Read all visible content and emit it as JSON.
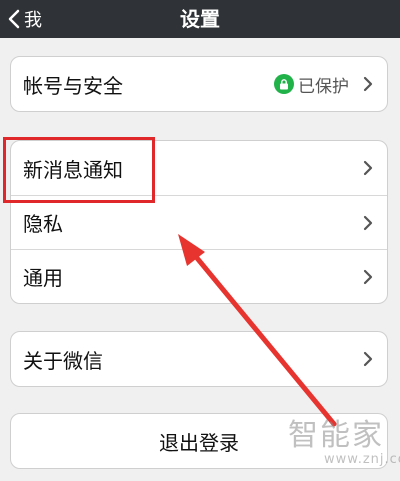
{
  "navbar": {
    "back_label": "我",
    "title": "设置"
  },
  "groups": [
    {
      "items": [
        {
          "label": "帐号与安全",
          "status": "已保护"
        }
      ]
    },
    {
      "items": [
        {
          "label": "新消息通知"
        },
        {
          "label": "隐私"
        },
        {
          "label": "通用"
        }
      ]
    },
    {
      "items": [
        {
          "label": "关于微信"
        }
      ]
    }
  ],
  "logout_label": "退出登录",
  "watermark": {
    "text": "智能家",
    "url": "www.znj.com"
  },
  "icons": {
    "back": "chevron-left-icon",
    "lock": "lock-icon",
    "row": "chevron-right-icon"
  },
  "colors": {
    "navbar": "#2f3236",
    "lock_badge": "#21b24a",
    "annotation": "#e0282a",
    "background": "#f0f0f0"
  }
}
